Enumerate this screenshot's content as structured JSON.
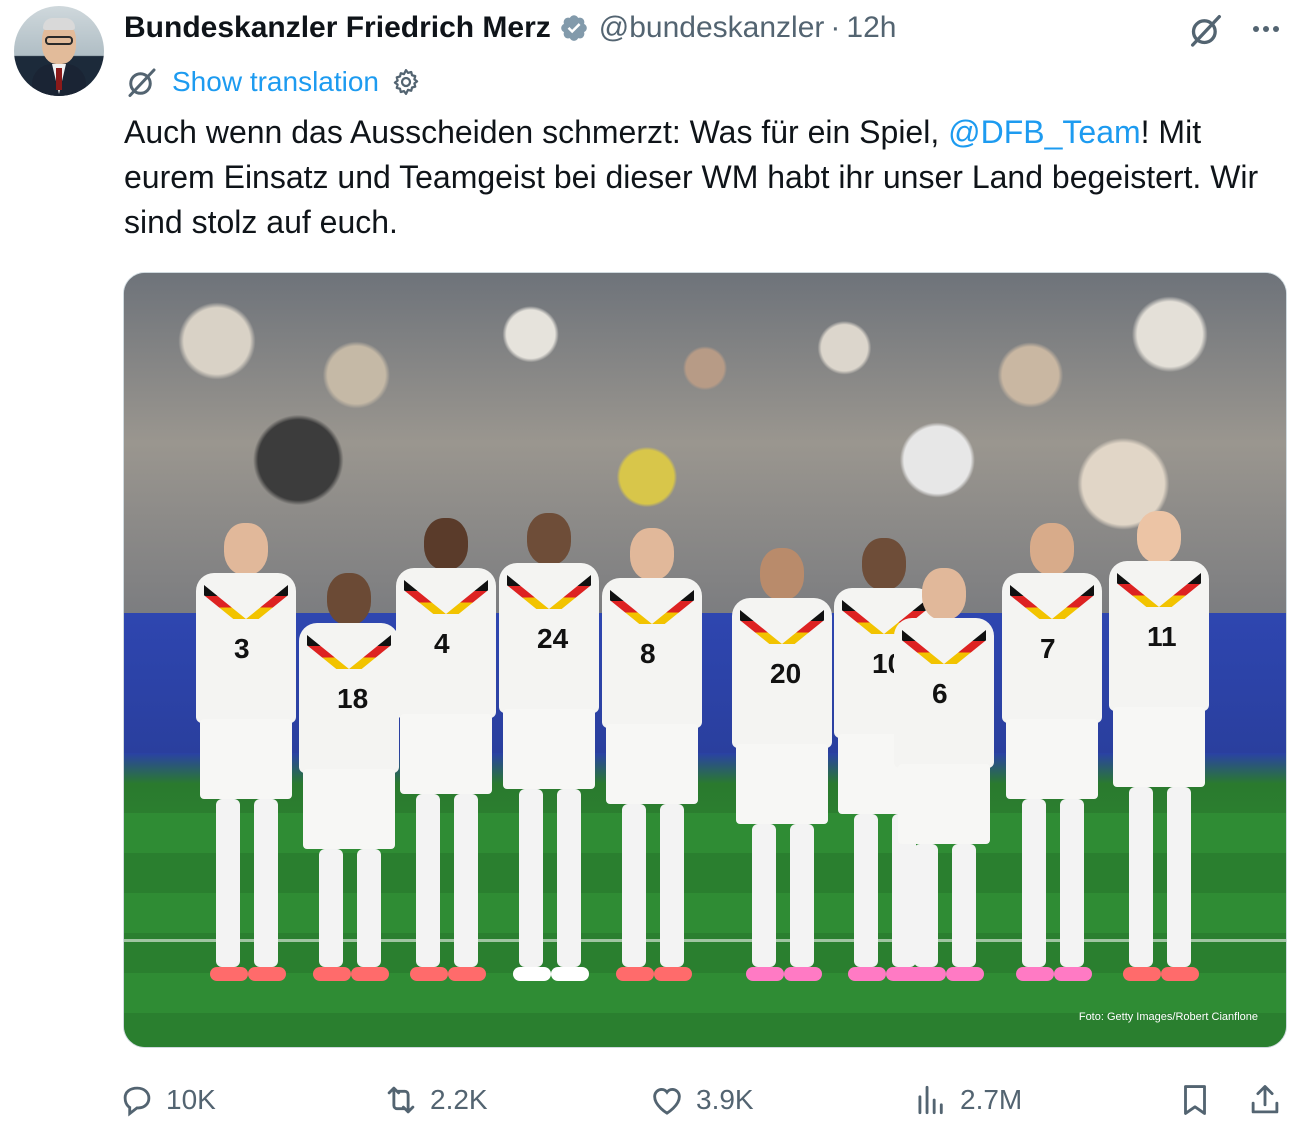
{
  "post": {
    "display_name": "Bundeskanzler Friedrich Merz",
    "handle": "@bundeskanzler",
    "separator": "·",
    "time": "12h",
    "translate_label": "Show translation",
    "text_part1": "Auch wenn das Ausscheiden schmerzt: Was für ein Spiel, ",
    "mention": "@DFB_Team",
    "text_part2": "! Mit eurem Einsatz und Teamgeist bei dieser WM habt ihr unser Land begeistert. Wir sind stolz auf euch.",
    "media": {
      "credit": "Foto: Getty Images/Robert Cianflone",
      "jersey_numbers": [
        "3",
        "18",
        "4",
        "24",
        "8",
        "20",
        "10",
        "6",
        "7",
        "11"
      ]
    }
  },
  "actions": {
    "replies": "10K",
    "reposts": "2.2K",
    "likes": "3.9K",
    "views": "2.7M"
  },
  "icons": {
    "verified": "verified-badge-icon",
    "grok": "grok-icon",
    "more": "more-icon",
    "gear": "gear-icon",
    "reply": "reply-icon",
    "repost": "repost-icon",
    "like": "heart-icon",
    "views": "views-icon",
    "bookmark": "bookmark-icon",
    "share": "share-icon"
  },
  "colors": {
    "link": "#1d9bf0",
    "secondary_text": "#536471",
    "primary_text": "#0f1419",
    "verified_badge": "#829aab"
  }
}
